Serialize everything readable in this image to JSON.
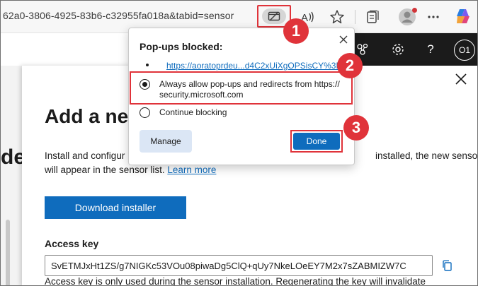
{
  "browser": {
    "url": "62a0-3806-4925-83b6-c32955fa018a&tabid=sensor",
    "icons": [
      "popups-blocked-icon",
      "read-aloud-icon",
      "favorite-star-icon",
      "collections-icon",
      "profile-icon",
      "more-icon",
      "copilot-icon"
    ]
  },
  "header": {
    "avatar_initials": "O1",
    "icons": [
      "network-icon",
      "gear-icon",
      "help-icon"
    ]
  },
  "page": {
    "left_edge_fragment": "de"
  },
  "flyout": {
    "title": "Add a ne",
    "description_seg1": "Install and configur",
    "description_seg2": "installed, the new sensor",
    "description_line2": "will appear in the sensor list.",
    "learn_more": "Learn more",
    "download_label": "Download installer",
    "access_key_label": "Access key",
    "access_key_value": "SvETMJxHt1ZS/g7NIGKc53VOu08piwaDg5ClQ+qUy7NkeLOeEY7M2x7sZABMIZW7C",
    "access_key_note": "Access key is only used during the sensor installation. Regenerating the key will invalidate"
  },
  "popup": {
    "title": "Pop-ups blocked:",
    "blocked_link": "https://aoratoprdeu...d4C2xUiXgOPSisCY%3D",
    "option_allow_line1": "Always allow pop-ups and redirects from https://",
    "option_allow_line2": "security.microsoft.com",
    "option_block": "Continue blocking",
    "selected_option": "allow",
    "manage_label": "Manage",
    "done_label": "Done"
  },
  "callouts": [
    "1",
    "2",
    "3"
  ],
  "colors": {
    "accent_blue": "#0f6cbd",
    "callout_red": "#e0333a",
    "header_dark": "#1b1b1b"
  }
}
